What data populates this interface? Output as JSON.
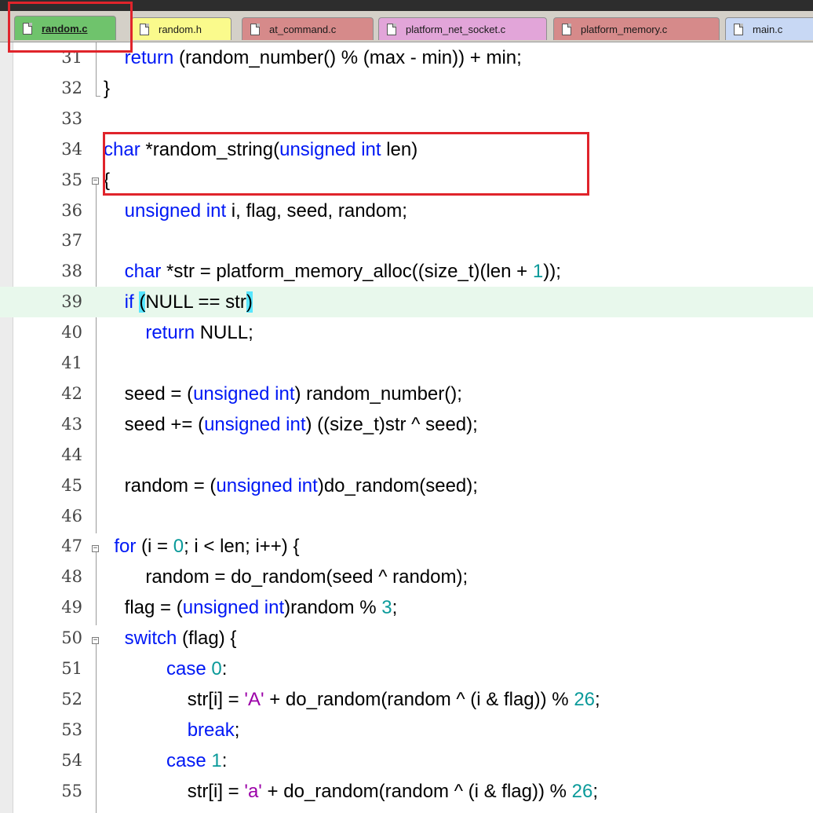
{
  "tabs": [
    {
      "label": "random.c",
      "color": "#6fc36c",
      "active": true
    },
    {
      "label": "random.h",
      "color": "#fafa8c",
      "active": false
    },
    {
      "label": "at_command.c",
      "color": "#d68a8a",
      "active": false
    },
    {
      "label": "platform_net_socket.c",
      "color": "#e2a5d9",
      "active": false
    },
    {
      "label": "platform_memory.c",
      "color": "#d68a8a",
      "active": false
    },
    {
      "label": "main.c",
      "color": "#c8d8f4",
      "active": false
    }
  ],
  "colors": {
    "keyword": "#0018f5",
    "number": "#0a9a9a",
    "string": "#9b00a8",
    "highlight_line": "#e8f8ec",
    "annotation": "#e0242b"
  },
  "lines": [
    {
      "n": "31",
      "code": [
        [
          "    ",
          ""
        ],
        [
          "return",
          "kw"
        ],
        [
          " (random_number() % (max - min)) + min;",
          ""
        ]
      ]
    },
    {
      "n": "32",
      "code": [
        [
          "}",
          ""
        ]
      ]
    },
    {
      "n": "33",
      "code": []
    },
    {
      "n": "34",
      "code": [
        [
          "char",
          "kw"
        ],
        [
          " *random_string(",
          ""
        ],
        [
          "unsigned int",
          "kw"
        ],
        [
          " len)",
          ""
        ]
      ]
    },
    {
      "n": "35",
      "code": [
        [
          "{",
          ""
        ]
      ]
    },
    {
      "n": "36",
      "code": [
        [
          "    ",
          ""
        ],
        [
          "unsigned int",
          "kw"
        ],
        [
          " i, flag, seed, random;",
          ""
        ]
      ]
    },
    {
      "n": "37",
      "code": []
    },
    {
      "n": "38",
      "code": [
        [
          "    ",
          ""
        ],
        [
          "char",
          "kw"
        ],
        [
          " *str = platform_memory_alloc((size_t)(len + ",
          ""
        ],
        [
          "1",
          "nm"
        ],
        [
          "));",
          ""
        ]
      ]
    },
    {
      "n": "39",
      "code": [
        [
          "    ",
          ""
        ],
        [
          "if",
          "kw"
        ],
        [
          " ",
          ""
        ],
        [
          "(",
          "br"
        ],
        [
          "NULL == str",
          ""
        ],
        [
          ")",
          "br"
        ]
      ],
      "highlight": true
    },
    {
      "n": "40",
      "code": [
        [
          "        ",
          ""
        ],
        [
          "return",
          "kw"
        ],
        [
          " NULL;",
          ""
        ]
      ]
    },
    {
      "n": "41",
      "code": []
    },
    {
      "n": "42",
      "code": [
        [
          "    seed = (",
          ""
        ],
        [
          "unsigned int",
          "kw"
        ],
        [
          ") random_number();",
          ""
        ]
      ]
    },
    {
      "n": "43",
      "code": [
        [
          "    seed += (",
          ""
        ],
        [
          "unsigned int",
          "kw"
        ],
        [
          ") ((size_t)str ^ seed);",
          ""
        ]
      ]
    },
    {
      "n": "44",
      "code": []
    },
    {
      "n": "45",
      "code": [
        [
          "    random = (",
          ""
        ],
        [
          "unsigned int",
          "kw"
        ],
        [
          ")do_random(seed);",
          ""
        ]
      ]
    },
    {
      "n": "46",
      "code": []
    },
    {
      "n": "47",
      "code": [
        [
          "  ",
          ""
        ],
        [
          "for",
          "kw"
        ],
        [
          " (i = ",
          ""
        ],
        [
          "0",
          "nm"
        ],
        [
          "; i < len; i++) {",
          ""
        ]
      ]
    },
    {
      "n": "48",
      "code": [
        [
          "        random = do_random(seed ^ random);",
          ""
        ]
      ]
    },
    {
      "n": "49",
      "code": [
        [
          "    flag = (",
          ""
        ],
        [
          "unsigned int",
          "kw"
        ],
        [
          ")random % ",
          ""
        ],
        [
          "3",
          "nm"
        ],
        [
          ";",
          ""
        ]
      ]
    },
    {
      "n": "50",
      "code": [
        [
          "    ",
          ""
        ],
        [
          "switch",
          "kw"
        ],
        [
          " (flag) {",
          ""
        ]
      ]
    },
    {
      "n": "51",
      "code": [
        [
          "            ",
          ""
        ],
        [
          "case",
          "kw"
        ],
        [
          " ",
          ""
        ],
        [
          "0",
          "nm"
        ],
        [
          ":",
          ""
        ]
      ]
    },
    {
      "n": "52",
      "code": [
        [
          "                str[i] = ",
          ""
        ],
        [
          "'A'",
          "st"
        ],
        [
          " + do_random(random ^ (i & flag)) % ",
          ""
        ],
        [
          "26",
          "nm"
        ],
        [
          ";",
          ""
        ]
      ]
    },
    {
      "n": "53",
      "code": [
        [
          "                ",
          ""
        ],
        [
          "break",
          "kw"
        ],
        [
          ";",
          ""
        ]
      ]
    },
    {
      "n": "54",
      "code": [
        [
          "            ",
          ""
        ],
        [
          "case",
          "kw"
        ],
        [
          " ",
          ""
        ],
        [
          "1",
          "nm"
        ],
        [
          ":",
          ""
        ]
      ]
    },
    {
      "n": "55",
      "code": [
        [
          "                str[i] = ",
          ""
        ],
        [
          "'a'",
          "st"
        ],
        [
          " + do_random(random ^ (i & flag)) % ",
          ""
        ],
        [
          "26",
          "nm"
        ],
        [
          ";",
          ""
        ]
      ]
    }
  ]
}
